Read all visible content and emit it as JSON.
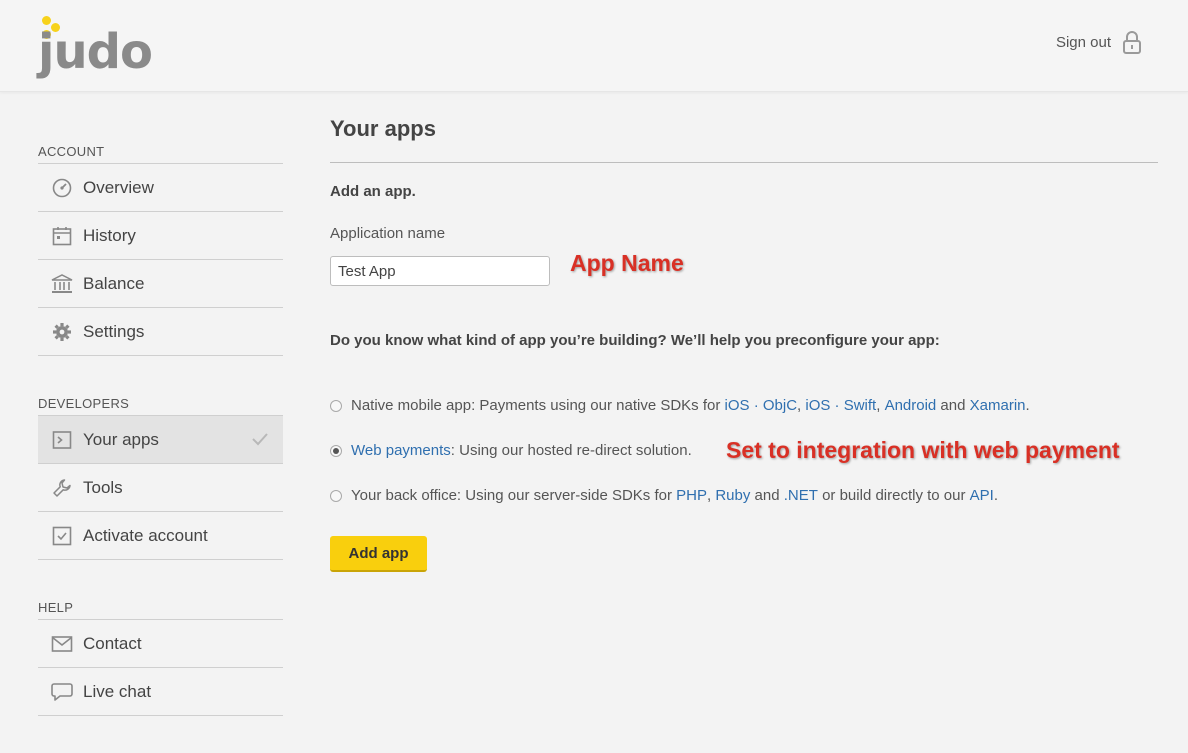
{
  "header": {
    "logo_text": "judo",
    "signout_label": "Sign out"
  },
  "sidebar": {
    "sections": [
      {
        "title": "ACCOUNT",
        "items": [
          {
            "label": "Overview",
            "icon": "dashboard-icon"
          },
          {
            "label": "History",
            "icon": "calendar-icon"
          },
          {
            "label": "Balance",
            "icon": "bank-icon"
          },
          {
            "label": "Settings",
            "icon": "gear-icon"
          }
        ]
      },
      {
        "title": "DEVELOPERS",
        "items": [
          {
            "label": "Your apps",
            "icon": "terminal-icon",
            "active": true
          },
          {
            "label": "Tools",
            "icon": "wrench-icon"
          },
          {
            "label": "Activate account",
            "icon": "checkbox-icon"
          }
        ]
      },
      {
        "title": "HELP",
        "items": [
          {
            "label": "Contact",
            "icon": "envelope-icon"
          },
          {
            "label": "Live chat",
            "icon": "chat-bubble-icon"
          }
        ]
      }
    ]
  },
  "main": {
    "title": "Your apps",
    "subheading": "Add an app.",
    "app_name_label": "Application name",
    "app_name_value": "Test App",
    "question": "Do you know what kind of app you’re building? We’ll help you preconfigure your app:",
    "options": {
      "native": {
        "prefix": "Native mobile app: Payments using our native SDKs for ",
        "link_ios_objc": "iOS · ObjC",
        "sep1": ", ",
        "link_ios_swift": "iOS · Swift",
        "sep2": ", ",
        "link_android": "Android",
        "sep3": " and ",
        "link_xamarin": "Xamarin",
        "suffix": ".",
        "checked": false
      },
      "web": {
        "link_web": "Web payments",
        "suffix": ": Using our hosted re-direct solution.",
        "checked": true
      },
      "backoffice": {
        "prefix": "Your back office: Using our server-side SDKs for ",
        "link_php": "PHP",
        "sep1": ", ",
        "link_ruby": "Ruby",
        "sep2": " and ",
        "link_net": ".NET",
        "sep3": " or build directly to our ",
        "link_api": "API",
        "suffix": ".",
        "checked": false
      }
    },
    "add_button_label": "Add app"
  },
  "annotations": {
    "app_name": "App Name",
    "web_payment": "Set to integration with web payment"
  },
  "colors": {
    "accent_yellow": "#f9cf0d",
    "link_blue": "#2f6faf",
    "annotation_red": "#d93025"
  }
}
